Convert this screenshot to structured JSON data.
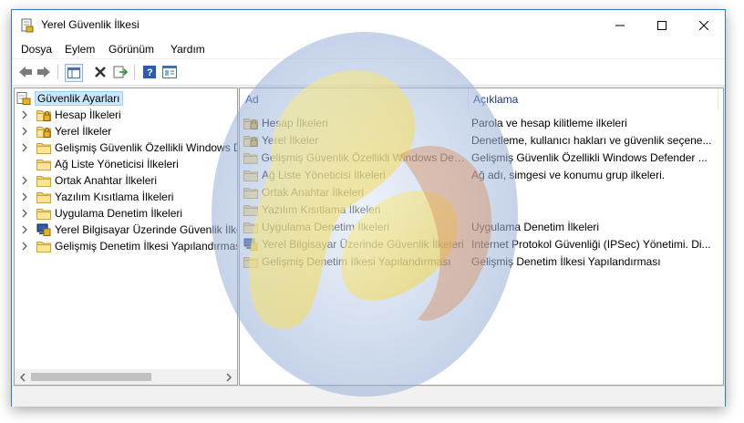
{
  "window": {
    "title": "Yerel Güvenlik İlkesi"
  },
  "menu": [
    "Dosya",
    "Eylem",
    "Görünüm",
    "Yardım"
  ],
  "toolbar": {
    "icons": [
      "back-arrow-icon",
      "forward-arrow-icon",
      "show-tree-icon",
      "delete-icon",
      "export-list-icon",
      "help-icon",
      "properties-icon"
    ]
  },
  "tree": {
    "root": "Güvenlik Ayarları",
    "items": [
      {
        "label": "Hesap İlkeleri",
        "expandable": true,
        "icon": "locked-folder"
      },
      {
        "label": "Yerel İlkeler",
        "expandable": true,
        "icon": "locked-folder"
      },
      {
        "label": "Gelişmiş Güvenlik Özellikli Windows Defender Güvenlik Duvarı",
        "expandable": true,
        "icon": "folder"
      },
      {
        "label": "Ağ Liste Yöneticisi İlkeleri",
        "expandable": false,
        "icon": "folder"
      },
      {
        "label": "Ortak Anahtar İlkeleri",
        "expandable": true,
        "icon": "folder"
      },
      {
        "label": "Yazılım Kısıtlama İlkeleri",
        "expandable": true,
        "icon": "folder"
      },
      {
        "label": "Uygulama Denetim İlkeleri",
        "expandable": true,
        "icon": "folder"
      },
      {
        "label": "Yerel Bilgisayar Üzerinde Güvenlik İlkeleri",
        "expandable": true,
        "icon": "ipsec"
      },
      {
        "label": "Gelişmiş Denetim İlkesi Yapılandırması",
        "expandable": true,
        "icon": "folder"
      }
    ]
  },
  "list": {
    "columns": {
      "name": "Ad",
      "description": "Açıklama"
    },
    "rows": [
      {
        "name": "Hesap İlkeleri",
        "desc": "Parola ve hesap kilitleme ilkeleri",
        "icon": "locked-folder"
      },
      {
        "name": "Yerel İlkeler",
        "desc": "Denetleme, kullanıcı hakları ve güvenlik seçene...",
        "icon": "locked-folder"
      },
      {
        "name": "Gelişmiş Güvenlik Özellikli Windows Defe...",
        "desc": "Gelişmiş Güvenlik Özellikli Windows Defender ...",
        "icon": "folder"
      },
      {
        "name": "Ağ Liste Yöneticisi İlkeleri",
        "desc": "Ağ adı, simgesi ve konumu grup ilkeleri.",
        "icon": "folder"
      },
      {
        "name": "Ortak Anahtar İlkeleri",
        "desc": "",
        "icon": "folder"
      },
      {
        "name": "Yazılım Kısıtlama İlkeleri",
        "desc": "",
        "icon": "folder"
      },
      {
        "name": "Uygulama Denetim İlkeleri",
        "desc": "Uygulama Denetim İlkeleri",
        "icon": "folder"
      },
      {
        "name": "Yerel Bilgisayar Üzerinde Güvenlik İlkeleri",
        "desc": "Internet Protokol Güvenliği (IPSec) Yönetimi. Di...",
        "icon": "ipsec"
      },
      {
        "name": "Gelişmiş Denetim İlkesi Yapılandırması",
        "desc": "Gelişmiş Denetim İlkesi Yapılandırması",
        "icon": "folder"
      }
    ]
  }
}
